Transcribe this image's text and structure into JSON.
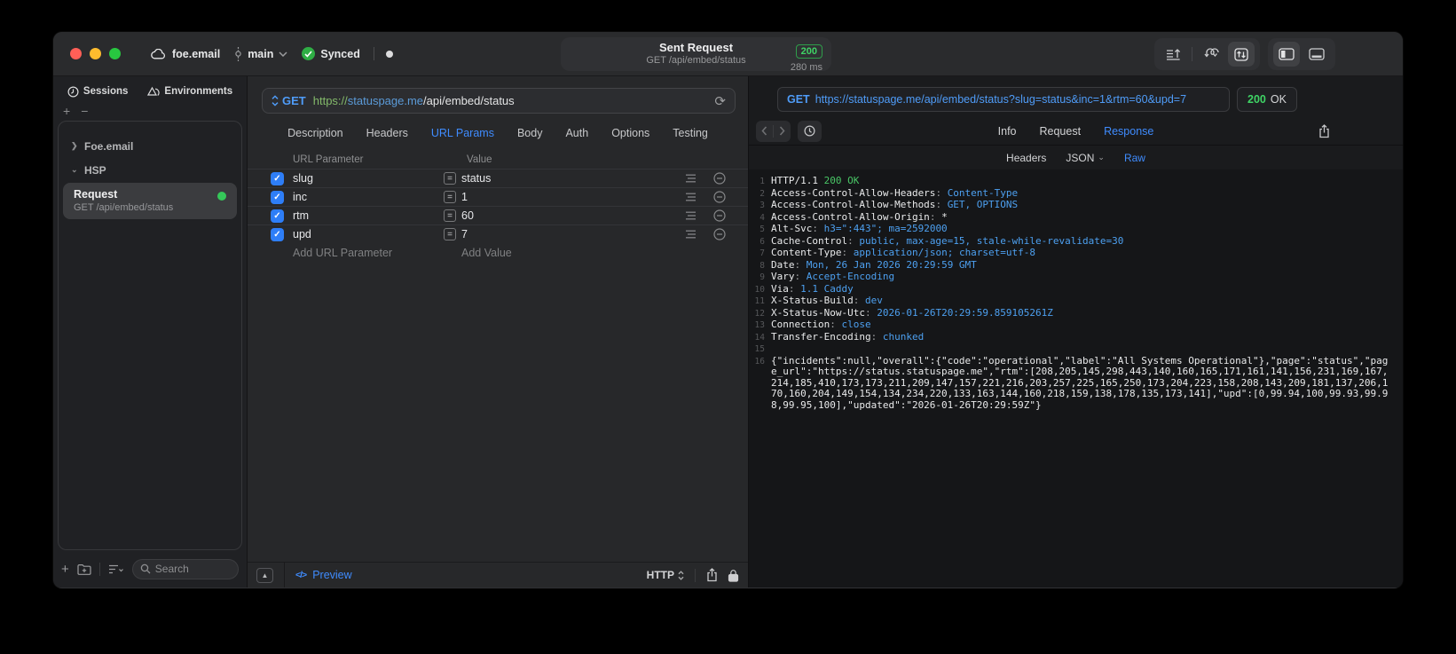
{
  "titlebar": {
    "project": "foe.email",
    "branch": "main",
    "sync_label": "Synced",
    "request_summary": {
      "title": "Sent Request",
      "subtitle": "GET /api/embed/status",
      "status_code": "200",
      "duration": "280 ms"
    }
  },
  "sidebar": {
    "tabs": [
      {
        "label": "Sessions"
      },
      {
        "label": "Environments"
      }
    ],
    "groups": [
      {
        "label": "Foe.email"
      },
      {
        "label": "HSP"
      }
    ],
    "selected_request": {
      "title": "Request",
      "subtitle": "GET /api/embed/status"
    },
    "search_placeholder": "Search"
  },
  "request_editor": {
    "method": "GET",
    "url": {
      "scheme": "https://",
      "host": "statuspage.me",
      "path": "/api/embed/status"
    },
    "tabs": [
      "Description",
      "Headers",
      "URL Params",
      "Body",
      "Auth",
      "Options",
      "Testing"
    ],
    "active_tab": "URL Params",
    "params": {
      "columns": {
        "name": "URL Parameter",
        "value": "Value"
      },
      "rows": [
        {
          "name": "slug",
          "value": "status",
          "enabled": true
        },
        {
          "name": "inc",
          "value": "1",
          "enabled": true
        },
        {
          "name": "rtm",
          "value": "60",
          "enabled": true
        },
        {
          "name": "upd",
          "value": "7",
          "enabled": true
        }
      ],
      "add_name_placeholder": "Add URL Parameter",
      "add_value_placeholder": "Add Value"
    },
    "footer": {
      "preview_label": "Preview",
      "code_glyph": "</>",
      "protocol": "HTTP"
    }
  },
  "response_viewer": {
    "request_line": {
      "method": "GET",
      "url": "https://statuspage.me/api/embed/status?slug=status&inc=1&rtm=60&upd=7"
    },
    "status": {
      "code": "200",
      "text": "OK"
    },
    "tabs": [
      "Info",
      "Request",
      "Response"
    ],
    "active_tab": "Response",
    "view_tabs": [
      "Headers",
      "JSON",
      "Raw"
    ],
    "active_view_tab": "Raw",
    "json_dropdown_tab": "JSON",
    "body_lines": [
      {
        "n": "1",
        "parts": [
          {
            "t": "HTTP/1.1 ",
            "c": "w"
          },
          {
            "t": "200 OK",
            "c": "g"
          }
        ]
      },
      {
        "n": "2",
        "parts": [
          {
            "t": "Access-Control-Allow-Headers",
            "c": "w"
          },
          {
            "t": ": ",
            "c": "d"
          },
          {
            "t": "Content-Type",
            "c": "b"
          }
        ]
      },
      {
        "n": "3",
        "parts": [
          {
            "t": "Access-Control-Allow-Methods",
            "c": "w"
          },
          {
            "t": ": ",
            "c": "d"
          },
          {
            "t": "GET, OPTIONS",
            "c": "b"
          }
        ]
      },
      {
        "n": "4",
        "parts": [
          {
            "t": "Access-Control-Allow-Origin",
            "c": "w"
          },
          {
            "t": ": ",
            "c": "d"
          },
          {
            "t": "*",
            "c": "w"
          }
        ]
      },
      {
        "n": "5",
        "parts": [
          {
            "t": "Alt-Svc",
            "c": "w"
          },
          {
            "t": ": ",
            "c": "d"
          },
          {
            "t": "h3=\":443\"; ma=2592000",
            "c": "b"
          }
        ]
      },
      {
        "n": "6",
        "parts": [
          {
            "t": "Cache-Control",
            "c": "w"
          },
          {
            "t": ": ",
            "c": "d"
          },
          {
            "t": "public, max-age=15, stale-while-revalidate=30",
            "c": "b"
          }
        ]
      },
      {
        "n": "7",
        "parts": [
          {
            "t": "Content-Type",
            "c": "w"
          },
          {
            "t": ": ",
            "c": "d"
          },
          {
            "t": "application/json; charset=utf-8",
            "c": "b"
          }
        ]
      },
      {
        "n": "8",
        "parts": [
          {
            "t": "Date",
            "c": "w"
          },
          {
            "t": ": ",
            "c": "d"
          },
          {
            "t": "Mon, 26 Jan 2026 20:29:59 GMT",
            "c": "b"
          }
        ]
      },
      {
        "n": "9",
        "parts": [
          {
            "t": "Vary",
            "c": "w"
          },
          {
            "t": ": ",
            "c": "d"
          },
          {
            "t": "Accept-Encoding",
            "c": "b"
          }
        ]
      },
      {
        "n": "10",
        "parts": [
          {
            "t": "Via",
            "c": "w"
          },
          {
            "t": ": ",
            "c": "d"
          },
          {
            "t": "1.1 Caddy",
            "c": "b"
          }
        ]
      },
      {
        "n": "11",
        "parts": [
          {
            "t": "X-Status-Build",
            "c": "w"
          },
          {
            "t": ": ",
            "c": "d"
          },
          {
            "t": "dev",
            "c": "b"
          }
        ]
      },
      {
        "n": "12",
        "parts": [
          {
            "t": "X-Status-Now-Utc",
            "c": "w"
          },
          {
            "t": ": ",
            "c": "d"
          },
          {
            "t": "2026-01-26T20:29:59.859105261Z",
            "c": "b"
          }
        ]
      },
      {
        "n": "13",
        "parts": [
          {
            "t": "Connection",
            "c": "w"
          },
          {
            "t": ": ",
            "c": "d"
          },
          {
            "t": "close",
            "c": "b"
          }
        ]
      },
      {
        "n": "14",
        "parts": [
          {
            "t": "Transfer-Encoding",
            "c": "w"
          },
          {
            "t": ": ",
            "c": "d"
          },
          {
            "t": "chunked",
            "c": "b"
          }
        ]
      },
      {
        "n": "15",
        "parts": []
      },
      {
        "n": "16",
        "parts": [
          {
            "t": "{\"incidents\":null,\"overall\":{\"code\":\"operational\",\"label\":\"All Systems Operational\"},\"page\":\"status\",\"page_url\":\"https://status.statuspage.me\",\"rtm\":[208,205,145,298,443,140,160,165,171,161,141,156,231,169,167,214,185,410,173,173,211,209,147,157,221,216,203,257,225,165,250,173,204,223,158,208,143,209,181,137,206,170,160,204,149,154,134,234,220,133,163,144,160,218,159,138,178,135,173,141],\"upd\":[0,99.94,100,99.93,99.98,99.95,100],\"updated\":\"2026-01-26T20:29:59Z\"}",
            "c": "w"
          }
        ]
      }
    ]
  },
  "colors": {
    "accent_blue": "#3f8cff",
    "status_green": "#3fd465",
    "checkbox_blue": "#2e7ef7",
    "traffic_red": "#ff5f57",
    "traffic_yellow": "#febc2e",
    "traffic_green": "#28c840"
  }
}
